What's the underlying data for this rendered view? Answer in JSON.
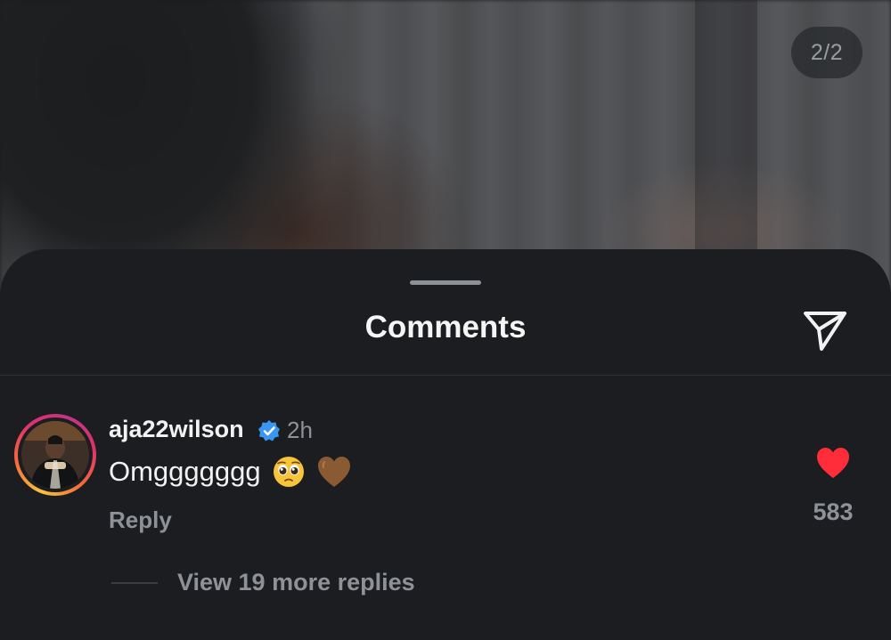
{
  "media": {
    "page_counter": "2/2"
  },
  "comments_sheet": {
    "title": "Comments",
    "share_icon": "paper-plane-icon"
  },
  "comment": {
    "username": "aja22wilson",
    "verified": true,
    "time": "2h",
    "text": "Omggggggg",
    "emojis": [
      "pleading-face-emoji",
      "brown-heart-emoji"
    ],
    "reply_label": "Reply",
    "liked": true,
    "like_count": "583",
    "view_replies_label": "View 19 more replies"
  },
  "colors": {
    "sheet_background": "#1b1d20",
    "like_red": "#ff2d3a",
    "verified_blue": "#3897f0",
    "secondary_text": "#8e9196"
  }
}
